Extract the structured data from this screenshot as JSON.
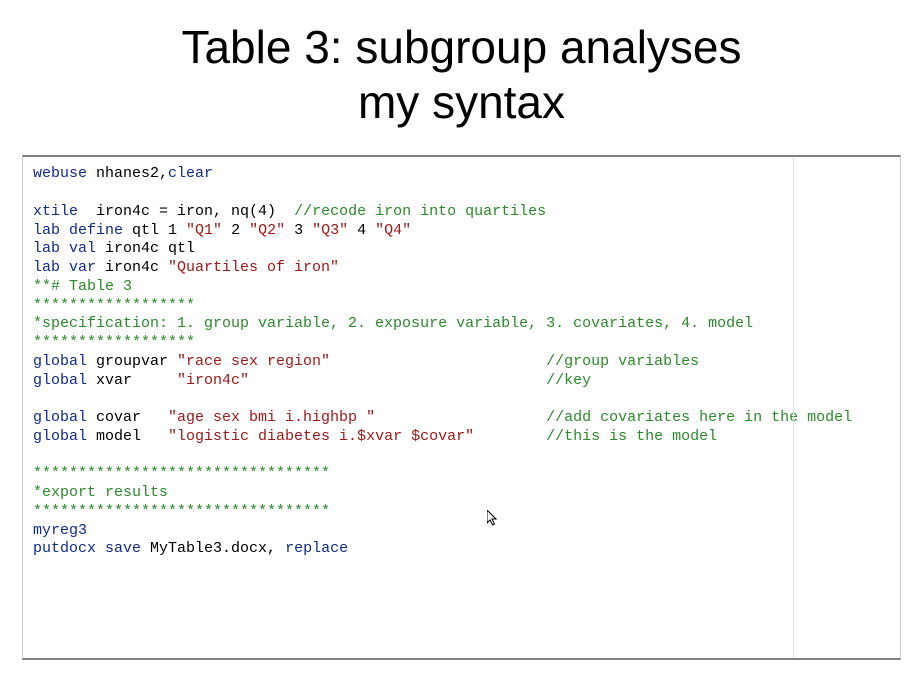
{
  "title_line1": "Table 3: subgroup analyses",
  "title_line2": "my syntax",
  "code": {
    "l1_cmd": "webuse ",
    "l1_txt": "nhanes2,",
    "l1_opt": "clear",
    "l3_cmd": "xtile  ",
    "l3_txt": "iron4c = iron, nq(4)  ",
    "l3_com": "//recode iron into quartiles",
    "l4_cmd": "lab define ",
    "l4_txt1": "qtl 1 ",
    "l4_s1": "\"Q1\"",
    "l4_txt2": " 2 ",
    "l4_s2": "\"Q2\"",
    "l4_txt3": " 3 ",
    "l4_s3": "\"Q3\"",
    "l4_txt4": " 4 ",
    "l4_s4": "\"Q4\"",
    "l5_cmd": "lab val ",
    "l5_txt": "iron4c qtl",
    "l6_cmd": "lab var ",
    "l6_txt": "iron4c ",
    "l6_str": "\"Quartiles of iron\"",
    "l7_com": "**# Table 3",
    "l8_com": "******************",
    "l9_com": "*specification: 1. group variable, 2. exposure variable, 3. covariates, 4. model",
    "l10_com": "******************",
    "l11_cmd": "global ",
    "l11_txt": "groupvar ",
    "l11_str": "\"race sex region\"",
    "l11_pad": "                        ",
    "l11_com": "//group variables",
    "l12_cmd": "global ",
    "l12_txt": "xvar     ",
    "l12_str": "\"iron4c\"",
    "l12_pad": "                                 ",
    "l12_com": "//key",
    "l14_cmd": "global ",
    "l14_txt": "covar   ",
    "l14_str": "\"age sex bmi i.highbp \"",
    "l14_pad": "                   ",
    "l14_com": "//add covariates here in the model",
    "l15_cmd": "global ",
    "l15_txt": "model   ",
    "l15_str": "\"logistic diabetes i.$xvar $covar\"",
    "l15_pad": "        ",
    "l15_com": "//this is the model",
    "l17_com": "*********************************",
    "l18_com": "*export results",
    "l19_com": "*********************************",
    "l20_cmd": "myreg3",
    "l21_cmd": "putdocx save ",
    "l21_txt": "MyTable3.docx, ",
    "l21_opt": "replace"
  }
}
